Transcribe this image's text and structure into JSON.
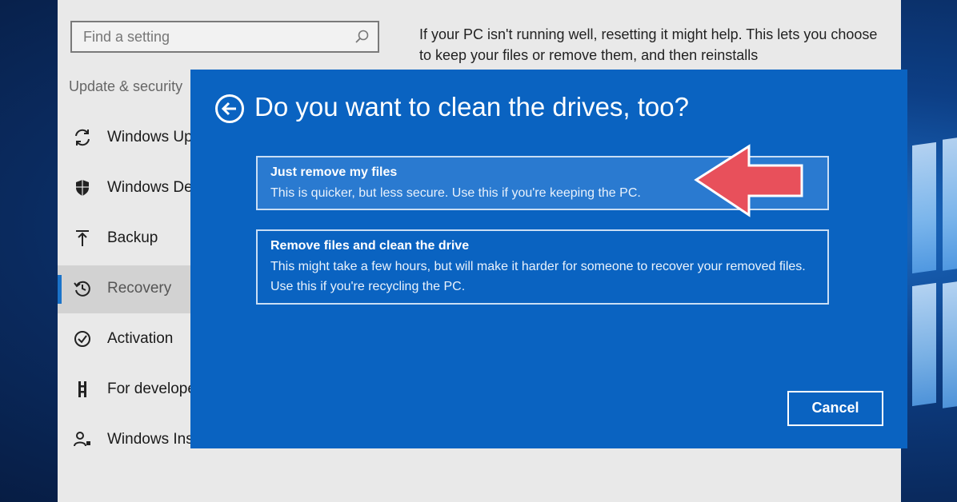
{
  "settings": {
    "search_placeholder": "Find a setting",
    "category": "Update & security",
    "nav_items": [
      {
        "label": "Windows Update",
        "icon": "refresh-icon"
      },
      {
        "label": "Windows Defender",
        "icon": "shield-icon"
      },
      {
        "label": "Backup",
        "icon": "backup-arrow-icon"
      },
      {
        "label": "Recovery",
        "icon": "history-icon",
        "active": true
      },
      {
        "label": "Activation",
        "icon": "check-circle-icon"
      },
      {
        "label": "For developers",
        "icon": "developer-icon"
      },
      {
        "label": "Windows Insider Program",
        "icon": "person-icon"
      }
    ],
    "reset_description": "If your PC isn't running well, resetting it might help. This lets you choose to keep your files or remove them, and then reinstalls"
  },
  "dialog": {
    "title": "Do you want to clean the drives, too?",
    "options": [
      {
        "title": "Just remove my files",
        "description": "This is quicker, but less secure. Use this if you're keeping the PC."
      },
      {
        "title": "Remove files and clean the drive",
        "description": "This might take a few hours, but will make it harder for someone to recover your removed files. Use this if you're recycling the PC."
      }
    ],
    "cancel_label": "Cancel"
  },
  "colors": {
    "dialog_bg": "#0a63c1",
    "accent": "#1a73c9",
    "arrow": "#e8505b",
    "settings_bg": "#e9e9e9"
  }
}
